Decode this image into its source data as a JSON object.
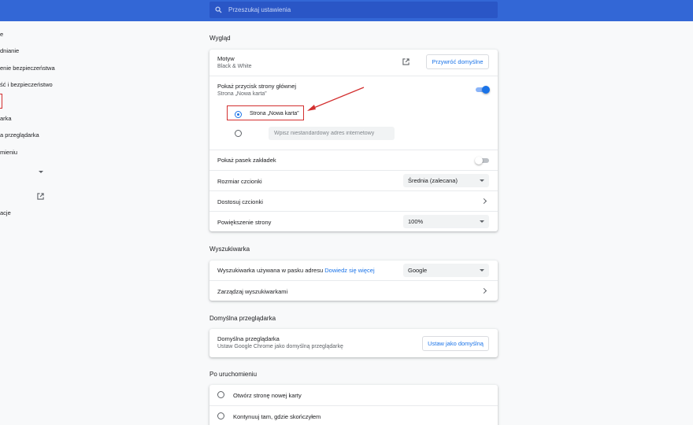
{
  "search": {
    "placeholder": "Przeszukaj ustawienia",
    "icon": "search-icon"
  },
  "sidebar": {
    "items": [
      {
        "label": "e",
        "top": 0
      },
      {
        "label": "dnianie"
      },
      {
        "label": "enie bezpieczeństwa"
      },
      {
        "label": "ść i bezpieczeństwo"
      },
      {
        "label": "arka"
      },
      {
        "label": "a przeglądarka"
      },
      {
        "label": "mieniu"
      },
      {
        "label": "acje"
      }
    ]
  },
  "appearance": {
    "section_title": "Wygląd",
    "theme": {
      "label": "Motyw",
      "value": "Black & White",
      "reset_label": "Przywróć domyślne"
    },
    "home_button": {
      "label": "Pokaż przycisk strony głównej",
      "value": "Strona „Nowa karta”",
      "enabled": true,
      "options": [
        {
          "label": "Strona „Nowa karta”",
          "selected": true
        },
        {
          "placeholder": "Wpisz niestandardowy adres internetowy",
          "selected": false
        }
      ]
    },
    "bookmarks_bar": {
      "label": "Pokaż pasek zakładek",
      "enabled": false
    },
    "font_size": {
      "label": "Rozmiar czcionki",
      "value": "Średnia (zalecana)"
    },
    "customize_fonts": {
      "label": "Dostosuj czcionki"
    },
    "page_zoom": {
      "label": "Powiększenie strony",
      "value": "100%"
    }
  },
  "search_engine": {
    "section_title": "Wyszukiwarka",
    "address_bar": {
      "label": "Wyszukiwarka używana w pasku adresu",
      "link": "Dowiedz się więcej",
      "value": "Google"
    },
    "manage": {
      "label": "Zarządzaj wyszukiwarkami"
    }
  },
  "default_browser": {
    "section_title": "Domyślna przeglądarka",
    "label": "Domyślna przeglądarka",
    "description": "Ustaw Google Chrome jako domyślną przeglądarkę",
    "button_label": "Ustaw jako domyślną"
  },
  "on_startup": {
    "section_title": "Po uruchomieniu",
    "options": [
      {
        "label": "Otwórz stronę nowej karty",
        "selected": false
      },
      {
        "label": "Kontynuuj tam, gdzie skończyłem",
        "selected": false
      }
    ]
  },
  "colors": {
    "accent": "#1a73e8",
    "topbar": "#3367d6",
    "annotation": "#d32f2f"
  }
}
